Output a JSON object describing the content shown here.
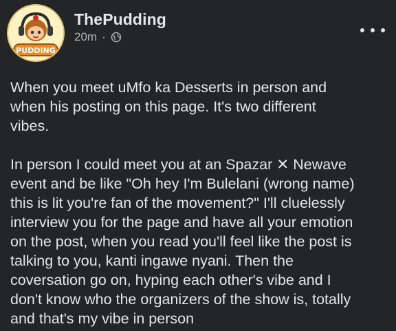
{
  "post": {
    "author": "ThePudding",
    "timestamp": "20m",
    "separator": "·",
    "audience_icon": "globe-icon",
    "more_icon": "more-options-icon",
    "avatar_logo_text": "PUDDING",
    "paragraphs": [
      {
        "lines": [
          "When you meet uMfo ka Desserts in person and",
          "when his posting on this page. It's two different",
          "vibes."
        ]
      },
      {
        "lines": [
          "In person I could meet you at an Spazar ✕ Newave",
          "event and be like \"Oh hey I'm Bulelani (wrong name)",
          "this is lit you're fan of the movement?\" I'll cluelessly",
          "interview you for the page and have all your emotion",
          "on the post,  when you read you'll feel like the post is",
          "talking to you, kanti ingawe nyani. Then the",
          "coversation go on, hyping each other's vibe and I",
          "don't know who the organizers of the show is, totally",
          "and that's my vibe in person"
        ]
      }
    ]
  },
  "colors": {
    "background": "#242526",
    "primary_text": "#e4e6eb",
    "secondary_text": "#b0b3b8",
    "avatar_bg": "#fff3c4",
    "logo_orange": "#f08a1c"
  }
}
